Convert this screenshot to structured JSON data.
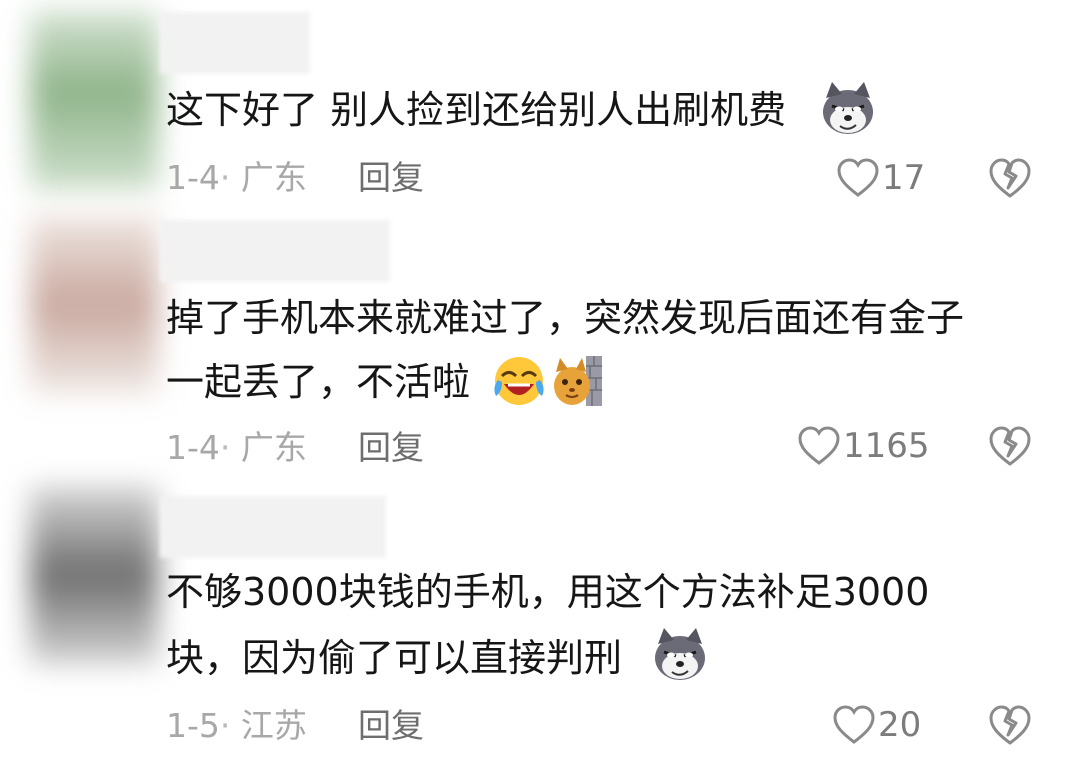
{
  "comments": [
    {
      "text_lines": [
        "这下好了 别人捡到还给别人出刷机费"
      ],
      "date": "1-4",
      "location": "广东",
      "reply_label": "回复",
      "likes": "17",
      "emojis": [
        "wolf-smirk"
      ]
    },
    {
      "text_lines": [
        "掉了手机本来就难过了，突然发现后面还有金子",
        "一起丢了，不活啦"
      ],
      "date": "1-4",
      "location": "广东",
      "reply_label": "回复",
      "likes": "1165",
      "emojis": [
        "laugh-cry",
        "cat-peek"
      ]
    },
    {
      "text_lines": [
        "不够3000块钱的手机，用这个方法补足3000",
        "块，因为偷了可以直接判刑"
      ],
      "date": "1-5",
      "location": "江苏",
      "reply_label": "回复",
      "likes": "20",
      "emojis": [
        "wolf-smirk"
      ]
    }
  ],
  "colors": {
    "text": "#161616",
    "meta": "#a8a8a8",
    "reply": "#6e6e6e",
    "icon": "#8a8a8a"
  }
}
